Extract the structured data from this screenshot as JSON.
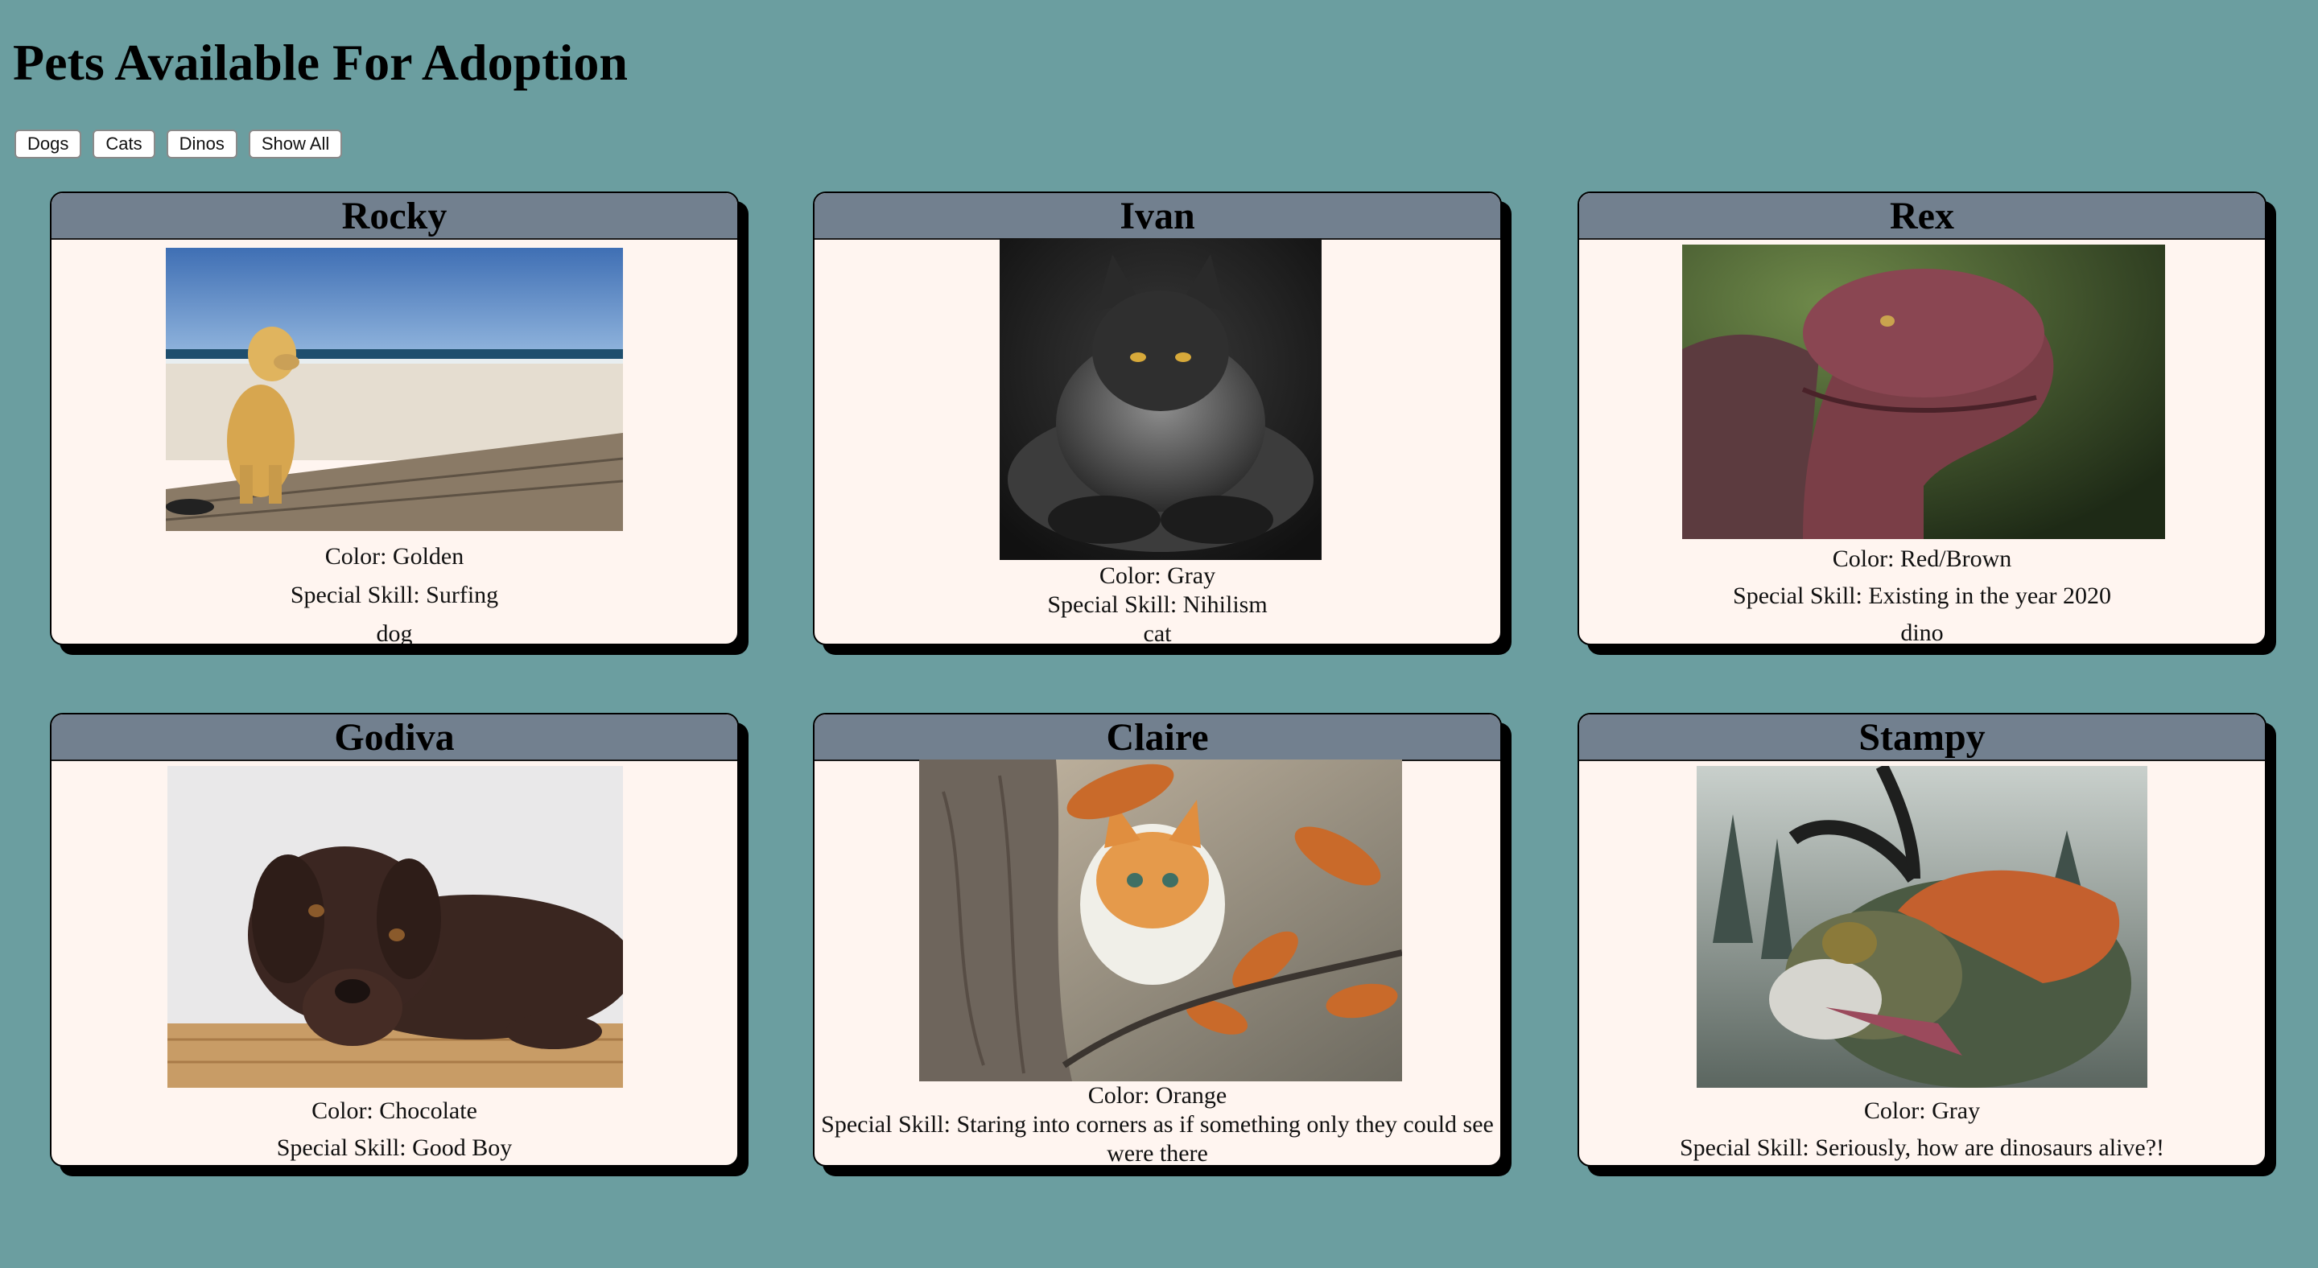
{
  "page": {
    "title": "Pets Available For Adoption"
  },
  "filters": [
    {
      "label": "Dogs"
    },
    {
      "label": "Cats"
    },
    {
      "label": "Dinos"
    },
    {
      "label": "Show All"
    }
  ],
  "colors": {
    "background": "#6b9ea0",
    "card_header": "#72808f",
    "card_body": "#fff5f0",
    "card_shadow": "#000000"
  },
  "pets": [
    {
      "name": "Rocky",
      "color": "Color: Golden",
      "skill": "Special Skill: Surfing",
      "type": "dog",
      "photo": "golden-retriever-on-beach-boardwalk"
    },
    {
      "name": "Ivan",
      "color": "Color: Gray",
      "skill": "Special Skill: Nihilism",
      "type": "cat",
      "photo": "gray-maine-coon-cat-dark-background"
    },
    {
      "name": "Rex",
      "color": "Color: Red/Brown",
      "skill": "Special Skill: Existing in the year 2020",
      "type": "dino",
      "photo": "red-brown-t-rex-head-in-forest"
    },
    {
      "name": "Godiva",
      "color": "Color: Chocolate",
      "skill": "Special Skill: Good Boy",
      "type": "dog",
      "photo": "chocolate-labrador-lying-on-floor"
    },
    {
      "name": "Claire",
      "color": "Color: Orange",
      "skill": "Special Skill: Staring into corners as if something only they could see were there",
      "type": "cat",
      "photo": "orange-white-cat-in-tree-autumn-leaves"
    },
    {
      "name": "Stampy",
      "color": "Color: Gray",
      "skill": "Special Skill: Seriously, how are dinosaurs alive?!",
      "type": "dino",
      "photo": "horned-ceratopsian-dinosaur-painting"
    }
  ]
}
